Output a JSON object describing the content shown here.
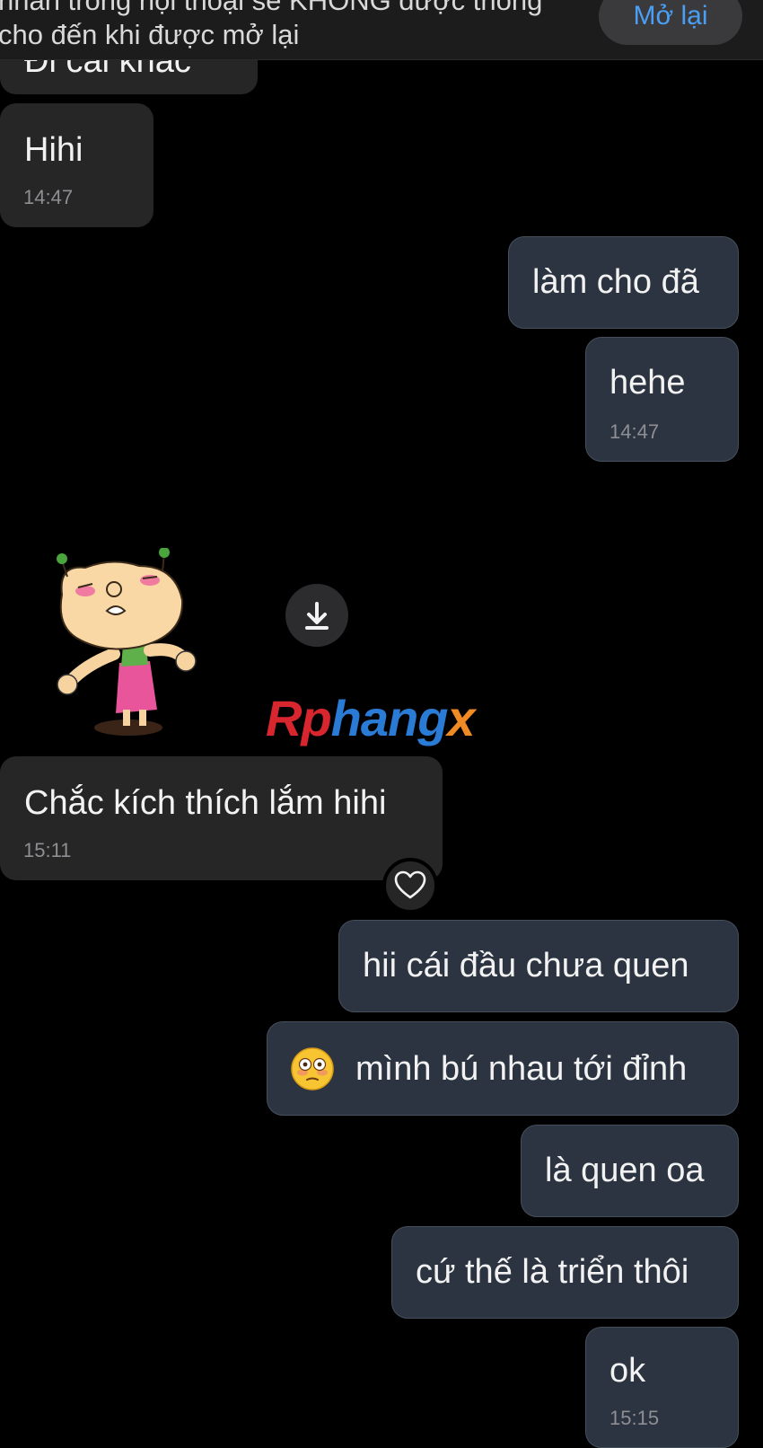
{
  "banner": {
    "line1": "nhắn trong hội thoại sẽ KHÔNG được thông",
    "line2": "cho đến khi được mở lại",
    "reopen_label": "Mở lại"
  },
  "messages": {
    "cut_off_text": "Đi cái khác",
    "hihi": {
      "text": "Hihi",
      "time": "14:47"
    },
    "lam_cho_da": {
      "text": "làm cho đã"
    },
    "hehe": {
      "text": "hehe",
      "time": "14:47"
    },
    "chac": {
      "text": "Chắc kích thích lắm hihi",
      "time": "15:11"
    },
    "hii": {
      "text": "hii cái đầu chưa quen"
    },
    "minh_bu": {
      "text": "mình bú nhau tới đỉnh"
    },
    "la_quen": {
      "text": "là quen oa"
    },
    "cu_the": {
      "text": "cứ thế là triển thôi"
    },
    "ok": {
      "text": "ok",
      "time": "15:15"
    }
  },
  "watermark": {
    "text_red": "Rp",
    "text_blue": "hang",
    "text_orange": "x"
  },
  "icons": {
    "download": "download-icon",
    "heart": "heart-outline-icon",
    "emoji": "flushed-face-emoji",
    "sticker": "cartoon-cat-sticker"
  },
  "colors": {
    "background": "#000000",
    "incoming_bubble": "#262626",
    "outgoing_bubble": "#2b3440",
    "accent": "#4a9ff5",
    "timestamp": "#8e8e93"
  }
}
